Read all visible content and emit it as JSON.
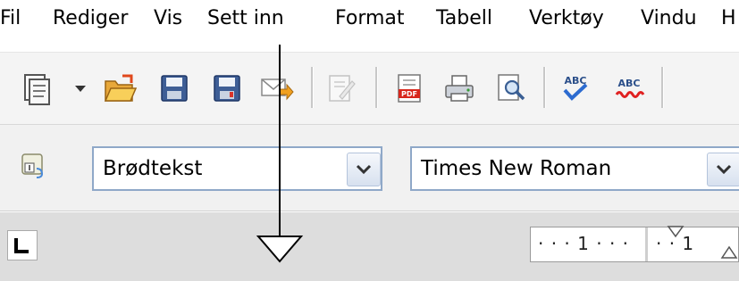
{
  "menu": {
    "items": [
      "Fil",
      "Rediger",
      "Vis",
      "Sett inn",
      "Format",
      "Tabell",
      "Verktøy",
      "Vindu",
      "H"
    ]
  },
  "toolbar": {
    "buttons": [
      "new-document-icon",
      "new-dropdown-arrow-icon",
      "open-folder-icon",
      "save-icon",
      "save-as-icon",
      "send-email-icon",
      "edit-file-icon",
      "export-pdf-icon",
      "print-icon",
      "page-preview-icon",
      "spellcheck-icon",
      "autospellcheck-icon"
    ]
  },
  "format_bar": {
    "style_value": "Brødtekst",
    "font_value": "Times New Roman"
  },
  "ruler": {
    "label_left": "· · · 1 · · ·",
    "label_right": "· · 1"
  },
  "colors": {
    "toolbar_bg": "#f4f4f4",
    "combo_border": "#8fa8c8",
    "ruler_bg": "#dddddd"
  }
}
